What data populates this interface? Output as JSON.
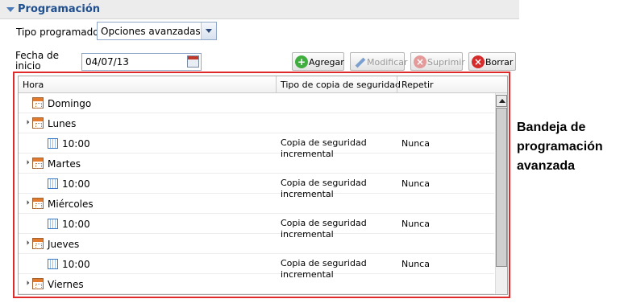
{
  "section": {
    "title": "Programación"
  },
  "form": {
    "tipo_label": "Tipo programado",
    "tipo_value": "Opciones avanzadas",
    "fecha_label_line1": "Fecha de",
    "fecha_label_line2": "inicio",
    "fecha_value": "04/07/13"
  },
  "toolbar": {
    "add_label": "Agregar",
    "modify_label": "Modificar",
    "suppress_label": "Suprimir",
    "delete_label": "Borrar"
  },
  "grid": {
    "columns": [
      "Hora",
      "Tipo de copia de seguridad",
      "Repetir"
    ],
    "rows": [
      {
        "kind": "day",
        "label": "Domingo"
      },
      {
        "kind": "day",
        "label": "Lunes"
      },
      {
        "kind": "entry",
        "time": "10:00",
        "type_line1": "Copia de seguridad",
        "type_line2": "incremental",
        "repeat": "Nunca"
      },
      {
        "kind": "day",
        "label": "Martes"
      },
      {
        "kind": "entry",
        "time": "10:00",
        "type_line1": "Copia de seguridad",
        "type_line2": "incremental",
        "repeat": "Nunca"
      },
      {
        "kind": "day",
        "label": "Miércoles"
      },
      {
        "kind": "entry",
        "time": "10:00",
        "type_line1": "Copia de seguridad",
        "type_line2": "incremental",
        "repeat": "Nunca"
      },
      {
        "kind": "day",
        "label": "Jueves"
      },
      {
        "kind": "entry",
        "time": "10:00",
        "type_line1": "Copia de seguridad",
        "type_line2": "incremental",
        "repeat": "Nunca"
      },
      {
        "kind": "day",
        "label": "Viernes"
      }
    ]
  },
  "annotation": {
    "line1": "Bandeja de",
    "line2": "programación",
    "line3": "avanzada"
  },
  "colors": {
    "accent": "#1f4f8f",
    "highlight_border": "#e12a2a"
  }
}
